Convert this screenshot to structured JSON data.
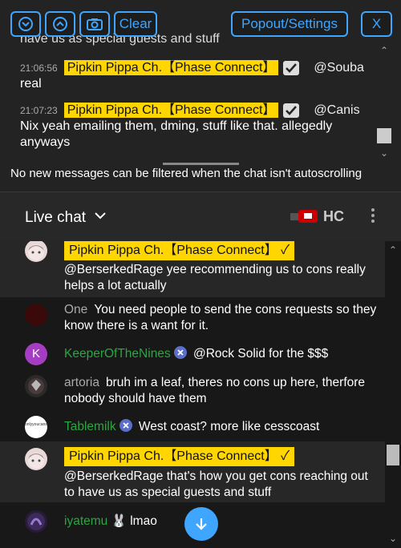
{
  "toolbar": {
    "clear_label": "Clear",
    "popout_label": "Popout/Settings",
    "close_label": "X"
  },
  "top_chat": {
    "cut_text": "have us as special guests and stuff",
    "messages": [
      {
        "time": "21:06:56",
        "author": "Pipkin Pippa Ch.【Phase Connect】",
        "mention": "@Souba",
        "text": "real"
      },
      {
        "time": "21:07:23",
        "author": "Pipkin Pippa Ch.【Phase Connect】",
        "mention": "@Canis",
        "text": "Nix yeah emailing them, dming, stuff like that. allegedly anyways"
      }
    ],
    "notice": "No new messages can be filtered when the chat isn't autoscrolling"
  },
  "live_chat": {
    "title": "Live chat",
    "hc_label": "HC",
    "messages": [
      {
        "author": "Pipkin Pippa Ch.【Phase Connect】",
        "text": "@BerserkedRage yee recommending us to cons really helps a lot actually"
      },
      {
        "author": "One",
        "text": "You need people to send the cons requests so they know there is a want for it."
      },
      {
        "avatar_letter": "K",
        "author": "KeeperOfTheNines",
        "text": "@Rock Solid for the $$$"
      },
      {
        "author": "artoria",
        "text": "bruh im a leaf, theres no cons up here, therfore nobody should have them"
      },
      {
        "avatar_text": "onlyyoucanseethisimage",
        "author": "Tablemilk",
        "text": "West coast? more like cesscoast"
      },
      {
        "author": "Pipkin Pippa Ch.【Phase Connect】",
        "text": "@BerserkedRage that's how you get cons reaching out to have us as special guests and stuff"
      },
      {
        "author": "iyatemu",
        "text": "lmao"
      }
    ]
  },
  "colors": {
    "accent": "#3ea6ff",
    "owner": "#ffd600",
    "member_name": "#2ba640"
  }
}
